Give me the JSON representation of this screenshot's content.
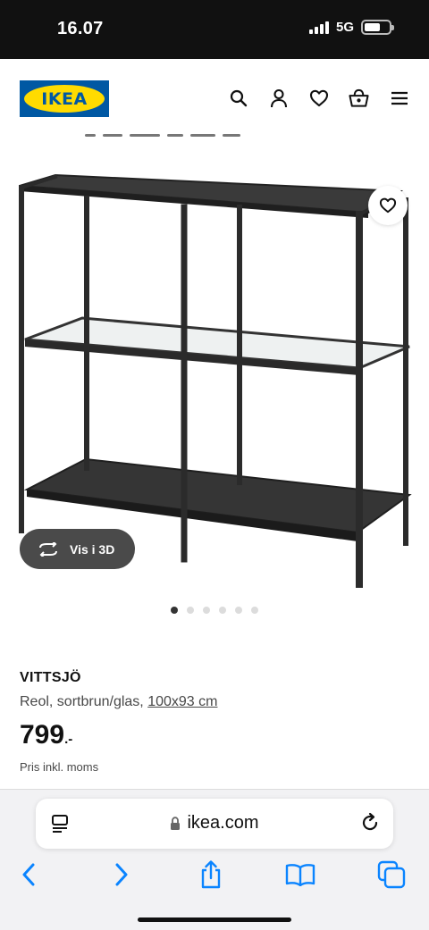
{
  "status_bar": {
    "time": "16.07",
    "network": "5G"
  },
  "header": {
    "logo_text": "IKEA",
    "icons": [
      "search-icon",
      "profile-icon",
      "heart-icon",
      "basket-icon",
      "menu-icon"
    ]
  },
  "gallery": {
    "view3d_label": "Vis i 3D",
    "image_count": 6,
    "active_index": 0
  },
  "product": {
    "name": "VITTSJÖ",
    "description": "Reol, sortbrun/glas,",
    "dimensions": "100x93 cm",
    "price_integer": "799",
    "price_suffix": ".-",
    "price_note": "Pris inkl. moms"
  },
  "browser": {
    "url": "ikea.com"
  },
  "colors": {
    "brand_blue": "#0058a3",
    "brand_yellow": "#ffdb00",
    "ios_blue": "#0a84ff"
  }
}
